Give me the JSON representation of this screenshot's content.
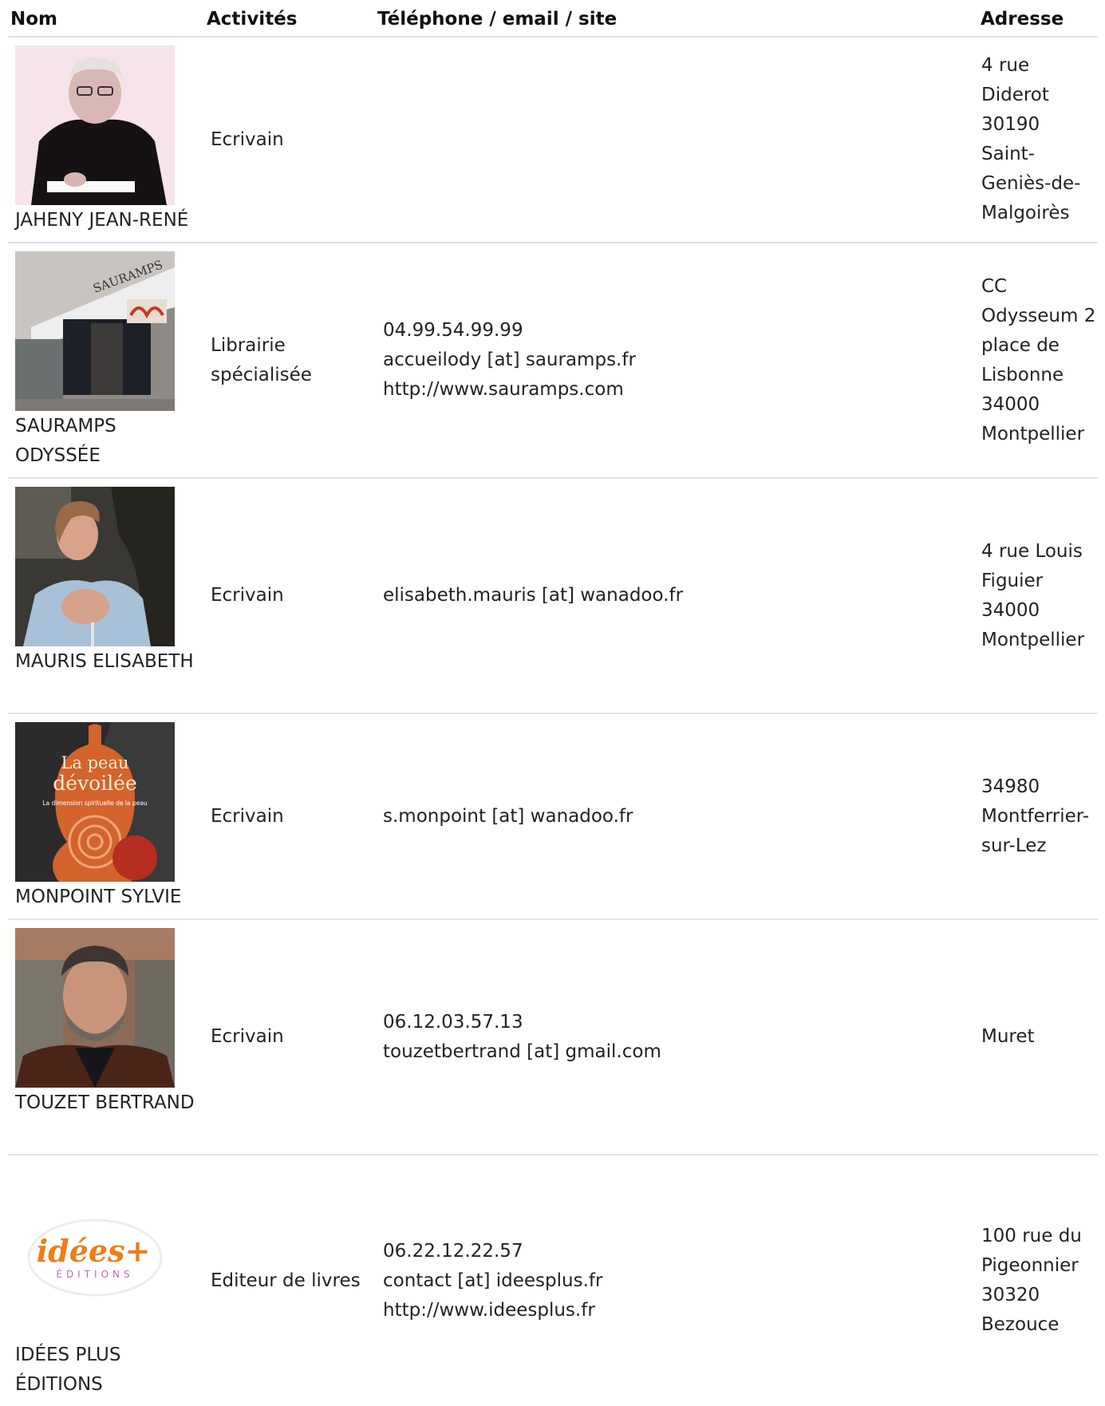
{
  "headers": {
    "nom": "Nom",
    "activites": "Activités",
    "contact": "Téléphone / email / site",
    "adresse": "Adresse"
  },
  "rows": [
    {
      "name": "JAHENY JEAN-RENÉ",
      "activity": "Ecrivain",
      "contact": [],
      "address": "4 rue Diderot 30190 Saint-Geniès-de-Malgoirès"
    },
    {
      "name": "SAURAMPS ODYSSÉE",
      "activity": "Librairie spécialisée",
      "contact": [
        "04.99.54.99.99",
        "accueilody [at] sauramps.fr",
        "http://www.sauramps.com"
      ],
      "address": "CC Odysseum 2 place de Lisbonne 34000 Montpellier",
      "image_text": "SAURAMPS"
    },
    {
      "name": "MAURIS ELISABETH",
      "activity": "Ecrivain",
      "contact": [
        "elisabeth.mauris [at] wanadoo.fr"
      ],
      "address": "4 rue Louis Figuier 34000 Montpellier"
    },
    {
      "name": "MONPOINT SYLVIE",
      "activity": "Ecrivain",
      "contact": [
        "s.monpoint [at] wanadoo.fr"
      ],
      "address": "34980 Montferrier-sur-Lez",
      "image_text": {
        "title_1": "La peau",
        "title_2": "dévoilée",
        "subtitle": "La dimension spirituelle de la peau"
      }
    },
    {
      "name": "TOUZET BERTRAND",
      "activity": "Ecrivain",
      "contact": [
        "06.12.03.57.13",
        "touzetbertrand [at] gmail.com"
      ],
      "address": "Muret"
    },
    {
      "name": "IDÉES PLUS ÉDITIONS",
      "activity": "Editeur de livres",
      "contact": [
        "06.22.12.22.57",
        "contact [at] ideesplus.fr",
        "http://www.ideesplus.fr"
      ],
      "address": "100 rue du Pigeonnier 30320 Bezouce",
      "image_text": {
        "logo": "idées+",
        "sub": "ÉDITIONS"
      }
    }
  ]
}
